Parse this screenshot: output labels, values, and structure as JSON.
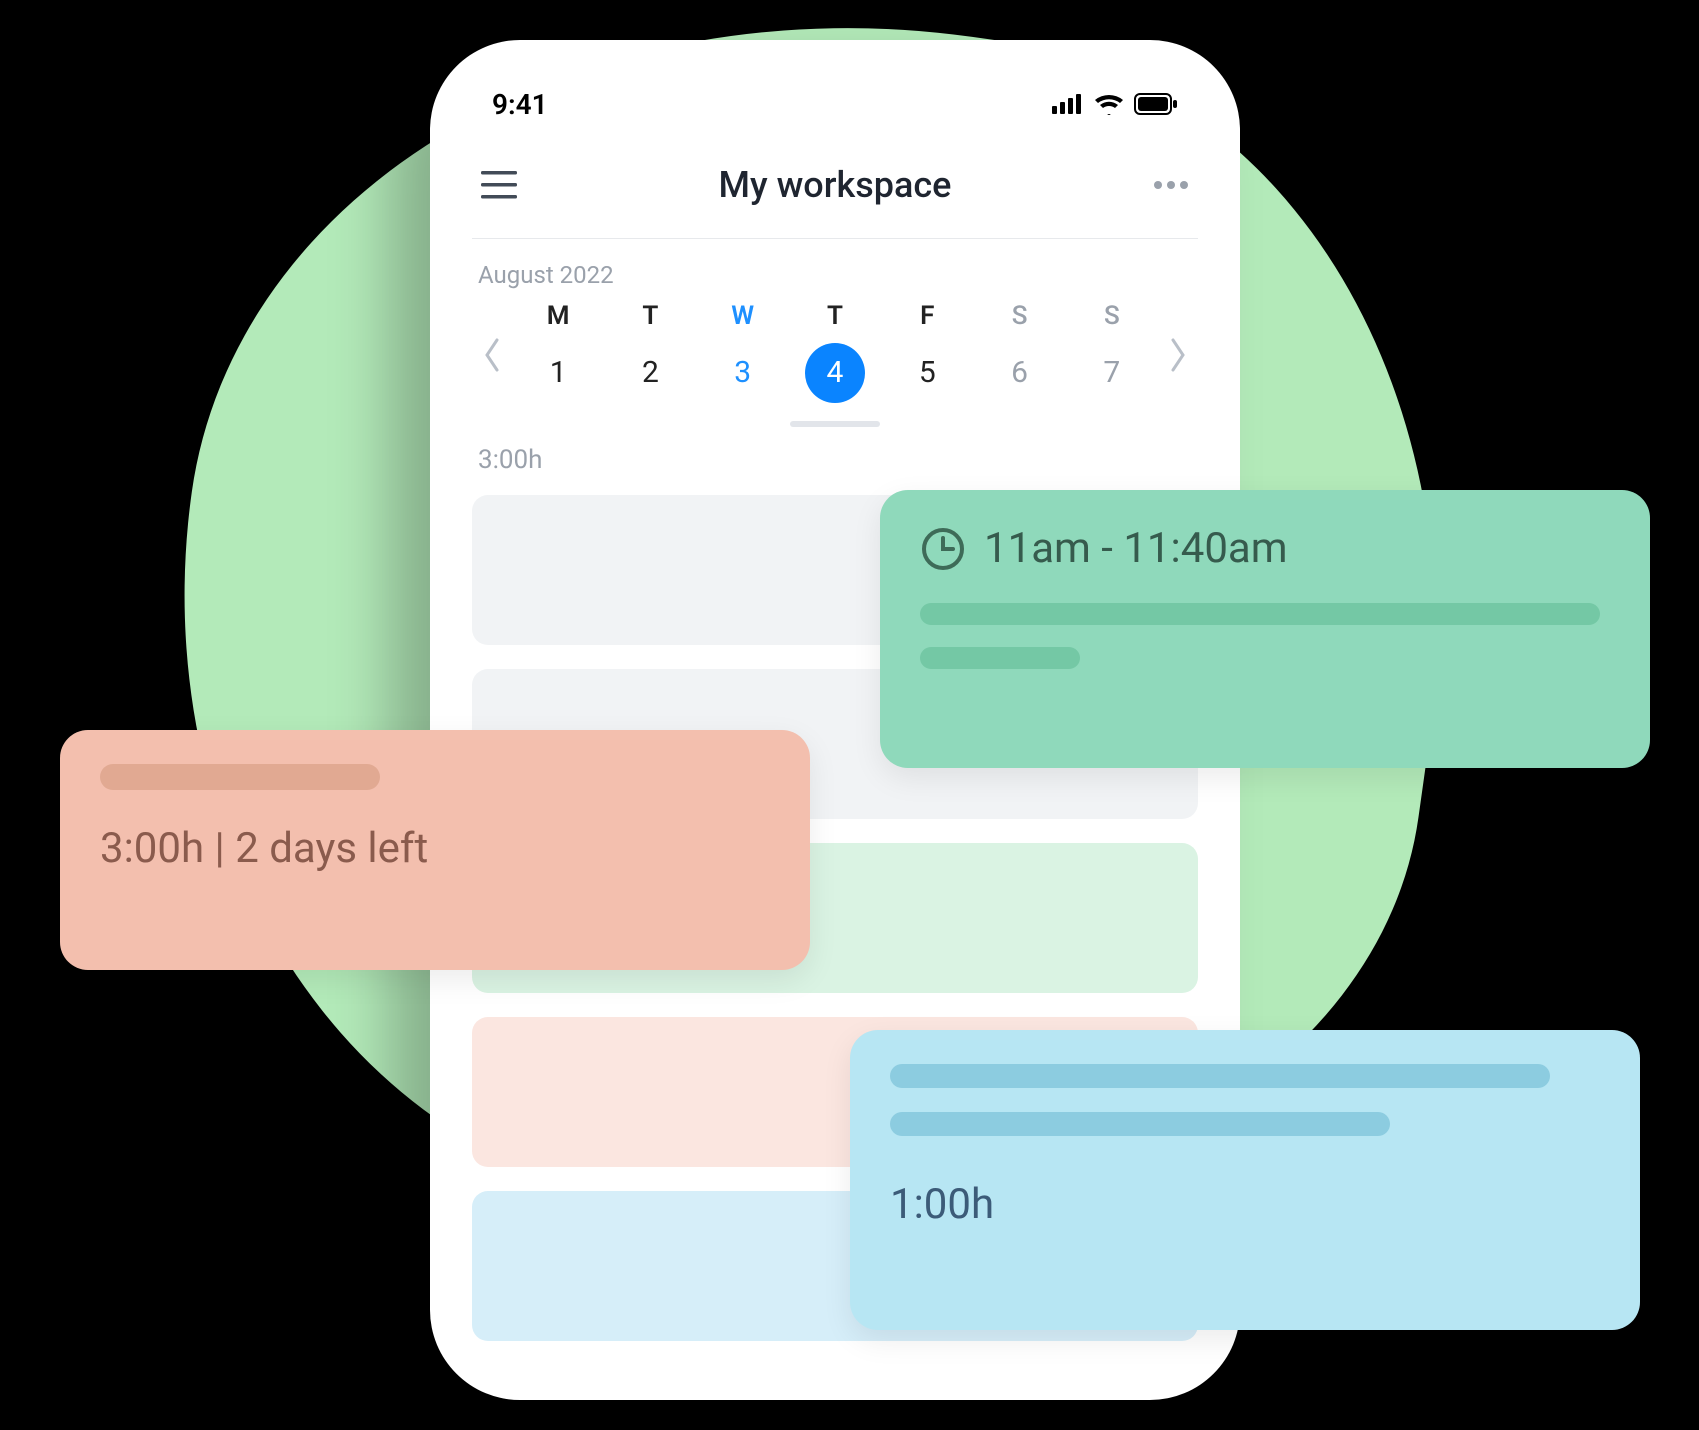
{
  "statusbar": {
    "time": "9:41"
  },
  "header": {
    "title": "My workspace"
  },
  "calendar": {
    "month_label": "August 2022",
    "days": [
      {
        "dow": "M",
        "num": "1",
        "weekend": false,
        "today": false,
        "selected": false
      },
      {
        "dow": "T",
        "num": "2",
        "weekend": false,
        "today": false,
        "selected": false
      },
      {
        "dow": "W",
        "num": "3",
        "weekend": false,
        "today": true,
        "selected": false
      },
      {
        "dow": "T",
        "num": "4",
        "weekend": false,
        "today": false,
        "selected": true
      },
      {
        "dow": "F",
        "num": "5",
        "weekend": false,
        "today": false,
        "selected": false
      },
      {
        "dow": "S",
        "num": "6",
        "weekend": true,
        "today": false,
        "selected": false
      },
      {
        "dow": "S",
        "num": "7",
        "weekend": true,
        "today": false,
        "selected": false
      }
    ]
  },
  "summary": {
    "total_hours": "3:00h"
  },
  "cards": {
    "green": {
      "time_range": "11am - 11:40am"
    },
    "pink": {
      "subtitle": "3:00h | 2 days left"
    },
    "blue": {
      "duration": "1:00h"
    }
  }
}
